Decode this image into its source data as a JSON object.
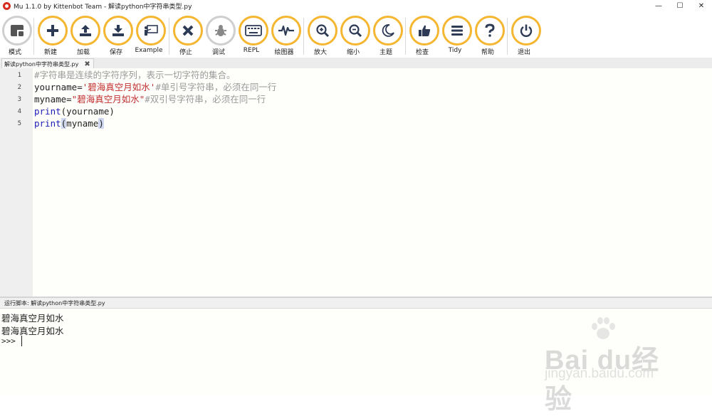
{
  "window": {
    "title": "Mu 1.1.0 by Kittenbot Team - 解读python中字符串类型.py",
    "controls": {
      "minimize": "—",
      "maximize": "☐",
      "close": "✕"
    }
  },
  "toolbar": {
    "buttons": [
      {
        "id": "mode",
        "label": "模式",
        "icon": "mode-icon"
      },
      {
        "id": "new",
        "label": "新建",
        "icon": "plus-icon"
      },
      {
        "id": "load",
        "label": "加载",
        "icon": "upload-icon"
      },
      {
        "id": "save",
        "label": "保存",
        "icon": "download-icon"
      },
      {
        "id": "example",
        "label": "Example",
        "icon": "presentation-icon"
      },
      {
        "id": "stop",
        "label": "停止",
        "icon": "close-icon"
      },
      {
        "id": "debug",
        "label": "调试",
        "icon": "bug-icon"
      },
      {
        "id": "repl",
        "label": "REPL",
        "icon": "keyboard-icon"
      },
      {
        "id": "plotter",
        "label": "绘图器",
        "icon": "pulse-icon"
      },
      {
        "id": "zoom-in",
        "label": "放大",
        "icon": "zoom-in-icon"
      },
      {
        "id": "zoom-out",
        "label": "缩小",
        "icon": "zoom-out-icon"
      },
      {
        "id": "theme",
        "label": "主题",
        "icon": "moon-icon"
      },
      {
        "id": "check",
        "label": "检查",
        "icon": "thumbs-up-icon"
      },
      {
        "id": "tidy",
        "label": "Tidy",
        "icon": "lines-icon"
      },
      {
        "id": "help",
        "label": "帮助",
        "icon": "question-icon"
      },
      {
        "id": "quit",
        "label": "退出",
        "icon": "power-icon"
      }
    ]
  },
  "tab": {
    "name": "解读python中字符串类型.py",
    "close": "✖"
  },
  "editor": {
    "line_numbers": [
      "1",
      "2",
      "3",
      "4",
      "5"
    ],
    "lines": [
      {
        "comment": "#字符串是连续的字符序列，表示一切字符的集合。"
      },
      {
        "ident": "yourname",
        "eq": "=",
        "str": "'碧海真空月如水'",
        "comment": "#单引号字符串，必须在同一行"
      },
      {
        "ident": "myname",
        "eq": "=",
        "str": "\"碧海真空月如水\"",
        "comment": "#双引号字符串，必须在同一行"
      },
      {
        "kw": "print",
        "open": "(",
        "arg": "yourname",
        "close": ")"
      },
      {
        "kw": "print",
        "open": "(",
        "arg": "myname",
        "close": ")"
      }
    ]
  },
  "runbar": {
    "text": "运行脚本: 解读python中字符串类型.py"
  },
  "console": {
    "output": [
      "碧海真空月如水",
      "碧海真空月如水"
    ],
    "prompt": ">>>"
  },
  "watermark": {
    "brand": "Bai du经验",
    "url": "jingyan.baidu.com"
  },
  "colors": {
    "accent": "#f5b731",
    "keyword": "#1b1bb8",
    "string": "#c22f2f",
    "comment": "#9a9a9a"
  }
}
